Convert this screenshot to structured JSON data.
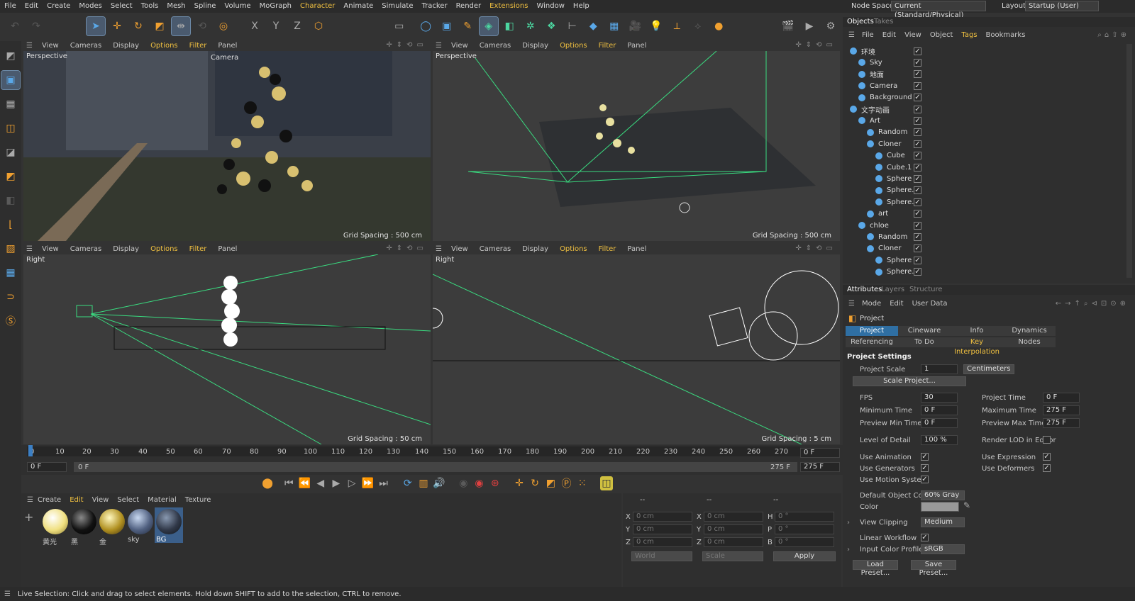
{
  "menu": [
    "File",
    "Edit",
    "Create",
    "Modes",
    "Select",
    "Tools",
    "Mesh",
    "Spline",
    "Volume",
    "MoGraph",
    "Character",
    "Animate",
    "Simulate",
    "Tracker",
    "Render",
    "Extensions",
    "Window",
    "Help"
  ],
  "menu_highlight": [
    "Character",
    "Extensions"
  ],
  "topright": {
    "node_space_label": "Node Space:",
    "node_space_value": "Current (Standard/Physical)",
    "layout_label": "Layout:",
    "layout_value": "Startup (User)"
  },
  "viewport_menu": [
    "View",
    "Cameras",
    "Display",
    "Options",
    "Filter",
    "Panel"
  ],
  "viewports": [
    {
      "label": "Perspective",
      "camera": "Camera",
      "grid": "Grid Spacing : 500 cm"
    },
    {
      "label": "Perspective",
      "camera": "",
      "grid": "Grid Spacing : 500 cm"
    },
    {
      "label": "Right",
      "camera": "",
      "grid": "Grid Spacing : 50 cm"
    },
    {
      "label": "Right",
      "camera": "",
      "grid": "Grid Spacing : 5 cm"
    }
  ],
  "objects_panel": {
    "tabs": [
      "Objects",
      "Takes"
    ],
    "menu": [
      "File",
      "Edit",
      "View",
      "Object",
      "Tags",
      "Bookmarks"
    ],
    "rows": [
      {
        "name": "环境",
        "indent": 0
      },
      {
        "name": "Sky",
        "indent": 1
      },
      {
        "name": "地面",
        "indent": 1
      },
      {
        "name": "Camera",
        "indent": 1
      },
      {
        "name": "Background",
        "indent": 1
      },
      {
        "name": "文字动画",
        "indent": 0
      },
      {
        "name": "Art",
        "indent": 1
      },
      {
        "name": "Random",
        "indent": 2
      },
      {
        "name": "Cloner",
        "indent": 2
      },
      {
        "name": "Cube",
        "indent": 3
      },
      {
        "name": "Cube.1",
        "indent": 3
      },
      {
        "name": "Sphere",
        "indent": 3
      },
      {
        "name": "Sphere.1",
        "indent": 3
      },
      {
        "name": "Sphere.2",
        "indent": 3
      },
      {
        "name": "art",
        "indent": 2
      },
      {
        "name": "chloe",
        "indent": 1
      },
      {
        "name": "Random",
        "indent": 2
      },
      {
        "name": "Cloner",
        "indent": 2
      },
      {
        "name": "Sphere",
        "indent": 3
      },
      {
        "name": "Sphere.2",
        "indent": 3
      }
    ]
  },
  "attributes": {
    "tabs": [
      "Attributes",
      "Layers",
      "Structure"
    ],
    "menu": [
      "Mode",
      "Edit",
      "User Data"
    ],
    "title": "Project",
    "subtabs": [
      "Project Settings",
      "Cineware",
      "Info",
      "Dynamics",
      "Referencing",
      "To Do",
      "Key Interpolation",
      "Nodes"
    ],
    "section": "Project Settings",
    "project_scale_label": "Project Scale",
    "project_scale_value": "1",
    "project_scale_unit": "Centimeters",
    "scale_project_btn": "Scale Project...",
    "fps_label": "FPS",
    "fps": "30",
    "project_time_label": "Project Time",
    "project_time": "0 F",
    "min_time_label": "Minimum Time",
    "min_time": "0 F",
    "max_time_label": "Maximum Time",
    "max_time": "275 F",
    "prev_min_label": "Preview Min Time",
    "prev_min": "0 F",
    "prev_max_label": "Preview Max Time",
    "prev_max": "275 F",
    "lod_label": "Level of Detail",
    "lod": "100 %",
    "render_lod_label": "Render LOD in Editor",
    "use_animation": "Use Animation",
    "use_expression": "Use Expression",
    "use_generators": "Use Generators",
    "use_deformers": "Use Deformers",
    "use_motion": "Use Motion System",
    "default_color_label": "Default Object Color",
    "default_color": "60% Gray",
    "color_label": "Color",
    "view_clipping_label": "View Clipping",
    "view_clipping": "Medium",
    "linear_workflow": "Linear Workflow",
    "input_profile_label": "Input Color Profile",
    "input_profile": "sRGB",
    "load_preset": "Load Preset...",
    "save_preset": "Save Preset..."
  },
  "timeline": {
    "ticks": [
      "0",
      "10",
      "20",
      "30",
      "40",
      "50",
      "60",
      "70",
      "80",
      "90",
      "100",
      "110",
      "120",
      "130",
      "140",
      "150",
      "160",
      "170",
      "180",
      "190",
      "200",
      "210",
      "220",
      "230",
      "240",
      "250",
      "260",
      "270"
    ],
    "current": "0 F",
    "start": "0 F",
    "range_left": "0 F",
    "range_right": "275 F",
    "end": "275 F",
    "end_field": "0 F"
  },
  "materials": {
    "menu": [
      "Create",
      "Edit",
      "View",
      "Select",
      "Material",
      "Texture"
    ],
    "items": [
      "黄光",
      "黑",
      "金",
      "sky",
      "BG"
    ]
  },
  "coords": {
    "col_heads": [
      "--",
      "--",
      "--"
    ],
    "rows": [
      {
        "a": "X",
        "av": "0 cm",
        "b": "X",
        "bv": "0 cm",
        "c": "H",
        "cv": "0 °"
      },
      {
        "a": "Y",
        "av": "0 cm",
        "b": "Y",
        "bv": "0 cm",
        "c": "P",
        "cv": "0 °"
      },
      {
        "a": "Z",
        "av": "0 cm",
        "b": "Z",
        "bv": "0 cm",
        "c": "B",
        "cv": "0 °"
      }
    ],
    "mode1": "World",
    "mode2": "Scale",
    "apply": "Apply"
  },
  "status": "Live Selection: Click and drag to select elements. Hold down SHIFT to add to the selection, CTRL to remove."
}
